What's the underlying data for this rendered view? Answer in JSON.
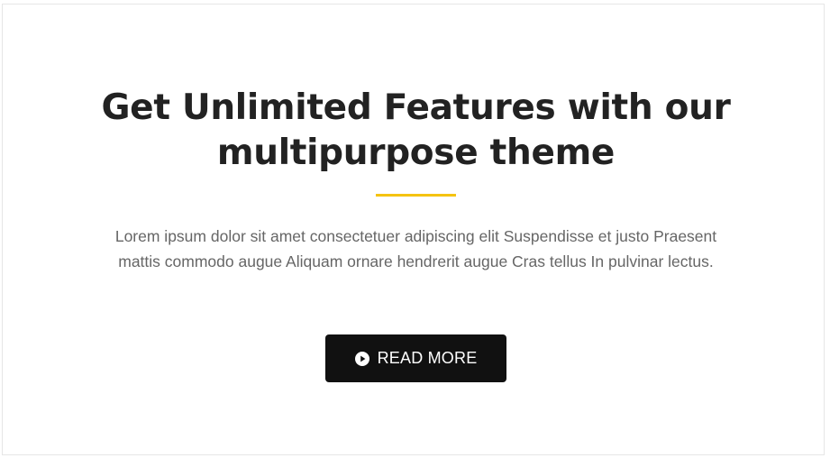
{
  "section": {
    "title_lines": [
      "Get Unlimited Features with our",
      "multipurpose theme"
    ],
    "description_lines": [
      "Lorem ipsum dolor sit amet consectetuer adipiscing elit Suspendisse et justo Praesent",
      "mattis commodo augue Aliquam ornare hendrerit augue Cras tellus In pulvinar lectus."
    ],
    "accent_color": "#f5c311"
  },
  "cta": {
    "label": "READ MORE",
    "icon": "play-circle-icon",
    "background": "#111111",
    "text_color": "#ffffff"
  }
}
